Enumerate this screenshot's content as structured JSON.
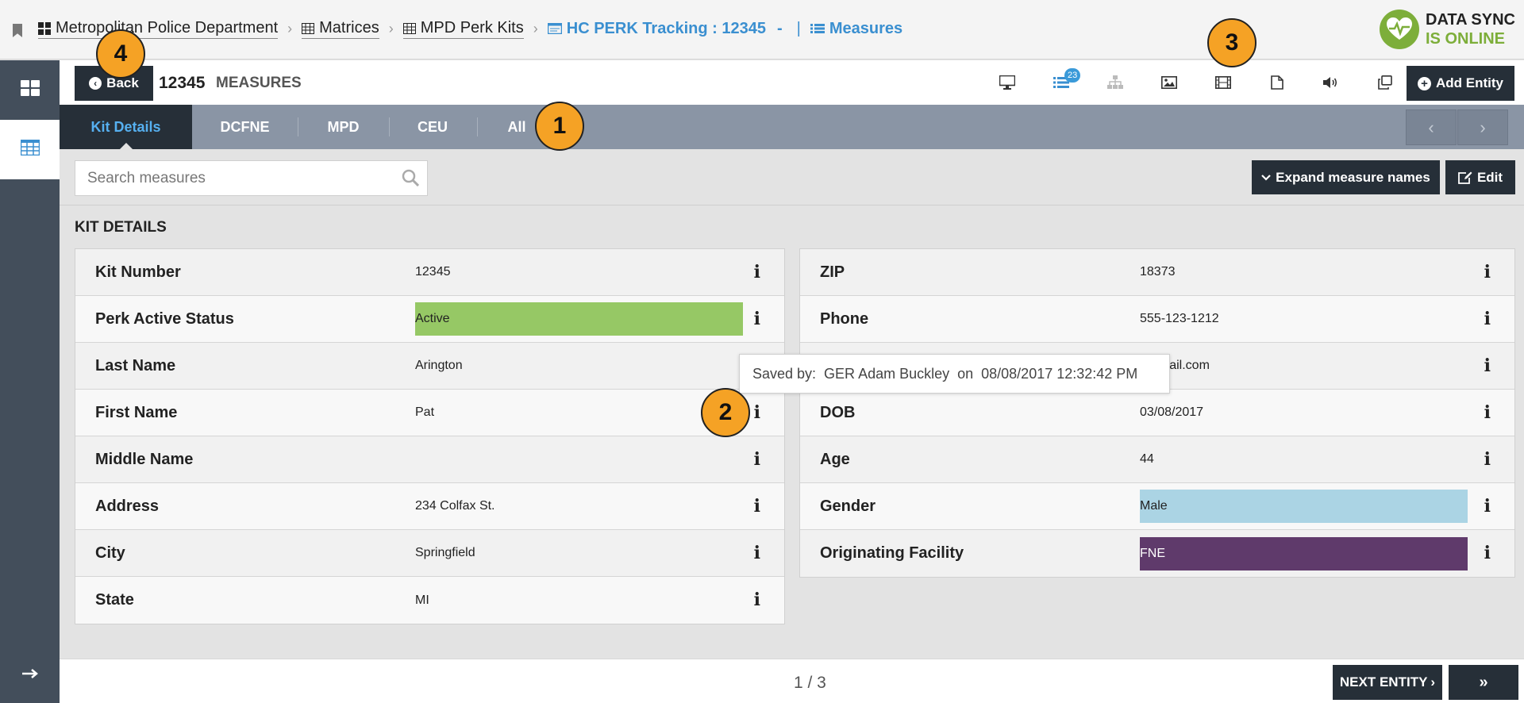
{
  "breadcrumbs": [
    {
      "label": "Metropolitan Police Department",
      "icon": "grid-icon"
    },
    {
      "label": "Matrices",
      "icon": "table-icon"
    },
    {
      "label": "MPD Perk Kits",
      "icon": "table-icon"
    }
  ],
  "current_crumb": {
    "title": "HC PERK Tracking : 12345",
    "dash": "-",
    "separator": "|",
    "section": "Measures"
  },
  "sync": {
    "line1": "DATA SYNC",
    "line2": "IS ONLINE",
    "color": "#7dae3a"
  },
  "header": {
    "back_label": "Back",
    "entity_id": "12345",
    "entity_label": "MEASURES",
    "add_label": "Add Entity"
  },
  "toolbar_icons": [
    {
      "name": "desktop-icon"
    },
    {
      "name": "list-icon",
      "badge": "23"
    },
    {
      "name": "hierarchy-icon"
    },
    {
      "name": "image-icon"
    },
    {
      "name": "film-icon"
    },
    {
      "name": "document-icon"
    },
    {
      "name": "audio-icon"
    },
    {
      "name": "copy-icon"
    }
  ],
  "tabs": [
    "Kit Details",
    "DCFNE",
    "MPD",
    "CEU",
    "All"
  ],
  "search": {
    "placeholder": "Search measures"
  },
  "buttons": {
    "expand": "Expand measure names",
    "edit": "Edit"
  },
  "section_title": "KIT DETAILS",
  "left_fields": [
    {
      "label": "Kit Number",
      "value": "12345"
    },
    {
      "label": "Perk Active Status",
      "value": "Active",
      "color": "#96c865"
    },
    {
      "label": "Last Name",
      "value": "Arington"
    },
    {
      "label": "First Name",
      "value": "Pat"
    },
    {
      "label": "Middle Name",
      "value": ""
    },
    {
      "label": "Address",
      "value": "234 Colfax St."
    },
    {
      "label": "City",
      "value": "Springfield"
    },
    {
      "label": "State",
      "value": "MI"
    }
  ],
  "right_fields": [
    {
      "label": "ZIP",
      "value": "18373"
    },
    {
      "label": "Phone",
      "value": "555-123-1212"
    },
    {
      "label": "",
      "value": "email.com"
    },
    {
      "label": "DOB",
      "value": "03/08/2017"
    },
    {
      "label": "Age",
      "value": "44"
    },
    {
      "label": "Gender",
      "value": "Male",
      "color": "#abd4e4"
    },
    {
      "label": "Originating Facility",
      "value": "FNE",
      "color": "#5f3a6b"
    }
  ],
  "tooltip": "Saved by:  GER Adam Buckley  on  08/08/2017 12:32:42 PM",
  "footer": {
    "page_indicator": "1 / 3",
    "next_label": "NEXT ENTITY",
    "last_label": "»"
  },
  "callouts": [
    "1",
    "2",
    "3",
    "4"
  ]
}
